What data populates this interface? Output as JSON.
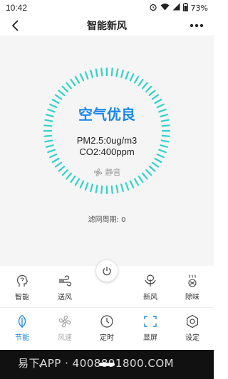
{
  "status": {
    "time": "10:42",
    "battery": "73%"
  },
  "header": {
    "title": "智能新风"
  },
  "main": {
    "quality": "空气优良",
    "pm": "PM2.5:0ug/m3",
    "co2": "CO2:400ppm",
    "mode": "静音",
    "filter": "滤网周期: 0"
  },
  "controls": {
    "row1": [
      {
        "label": "智能",
        "icon": "head-icon"
      },
      {
        "label": "送风",
        "icon": "wind-icon"
      },
      {
        "label": "新风",
        "icon": "leaf-icon"
      },
      {
        "label": "除味",
        "icon": "deodorize-icon"
      }
    ],
    "row2": [
      {
        "label": "节能",
        "icon": "leaf-icon"
      },
      {
        "label": "风速",
        "icon": "fan-icon"
      },
      {
        "label": "定时",
        "icon": "clock-icon"
      },
      {
        "label": "显屏",
        "icon": "screen-icon"
      },
      {
        "label": "设定",
        "icon": "gear-icon"
      }
    ]
  },
  "colors": {
    "accent": "#1c87e8",
    "dial": "#2ed3c8",
    "panel": "#f5f5f5"
  },
  "watermark": "易下APP · 4008891800.COM"
}
